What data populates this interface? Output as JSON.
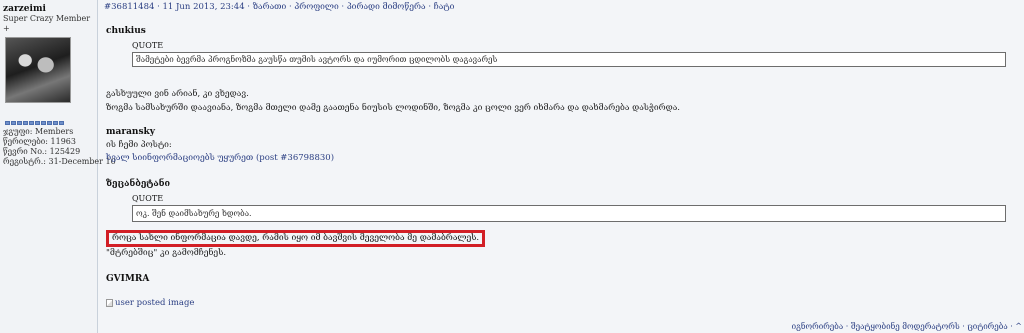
{
  "user": {
    "name": "zarzeimi",
    "group": "Super Crazy Member +",
    "pips": 10,
    "stats": [
      "ჯგუფი: Members",
      "წერილები: 11963",
      "წევრი No.: 125429",
      "რეგისტრ.: 31-December 10"
    ]
  },
  "header": {
    "post_link": "#36811484",
    "date": "· 11 Jun 2013, 23:44 ·",
    "links": [
      "ზარათი",
      "პროფილი",
      "პირადი მიმოწერა",
      "ჩატი"
    ]
  },
  "post": {
    "quote1": {
      "author": "chukius",
      "label": "QUOTE",
      "text": "შამეტები ბევრმა პროგნოზმა გაუსწა თუმის ავტორს და იუმორით ცდილობს დაგავარეს"
    },
    "lines1": [
      "გასხუული ვინ არიან, კი ვხედავ.",
      "ზოგმა სამსახურში დაავიანა, ზოგმა მთელი დამე გაათენა ნიუსის ლოდინში, ზოგმა კი ცოლი ვერ იხმარა და დახმარება დასჭირდა."
    ],
    "quote2": {
      "author": "maransky",
      "line1": "ის ჩემი პოსტი:",
      "link_text": "ხვალ სიინფორმაციოებს უყურეთ",
      "link_post": "(post #36798830)"
    },
    "quote3": {
      "author": "ზეცანბეტანი",
      "label": "QUOTE",
      "text": "ოკ. შენ დაიმსახურე ხდობა."
    },
    "highlight": "როცა სახლი ინფორმაცია დავდე, რამის იყო იმ ბავშვის მეველობა მე დამაბრალეს.",
    "line_after": "\"მტრებშიც\" კი გამომჩენეს.",
    "sign": "GVIMRA",
    "image_alt": "user posted image"
  },
  "footer": {
    "links": [
      "იგნორირება",
      "შეატყობინე მოდერატორს",
      "ციტირება",
      "^"
    ]
  }
}
